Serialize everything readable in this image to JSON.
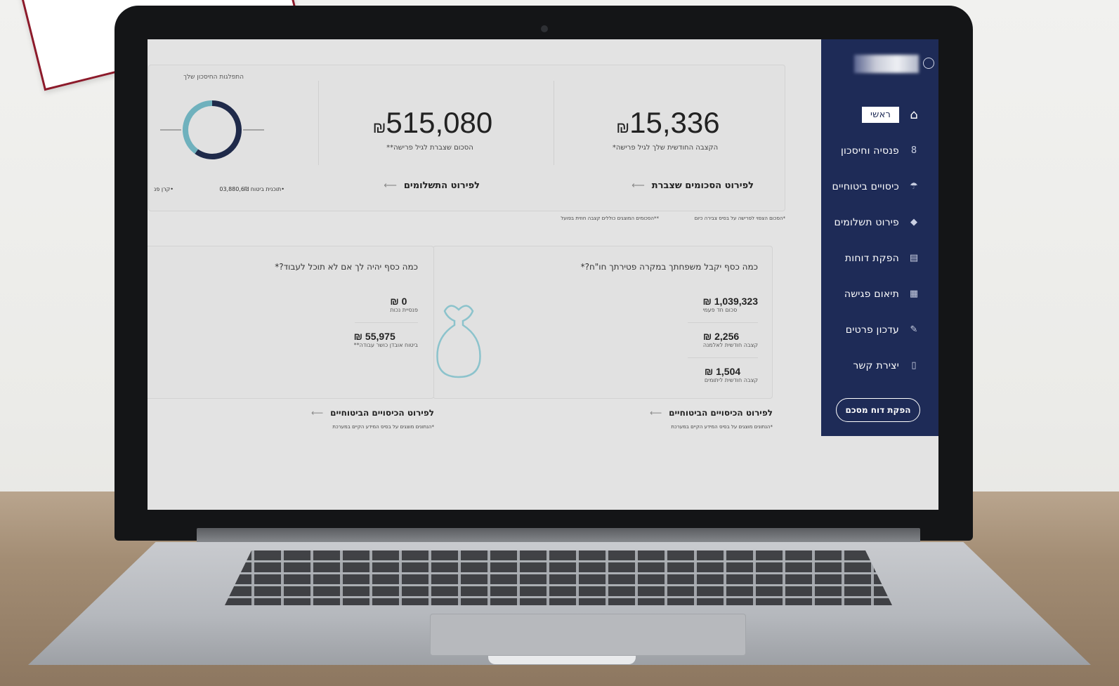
{
  "sidebar": {
    "items": [
      {
        "label": "ראשי",
        "icon": "home-icon",
        "glyph": "⌂"
      },
      {
        "label": "פנסיה וחיסכון",
        "icon": "savings-icon",
        "glyph": "8"
      },
      {
        "label": "כיסויים ביטוחיים",
        "icon": "umbrella-icon",
        "glyph": "☂"
      },
      {
        "label": "פירוט תשלומים",
        "icon": "coins-icon",
        "glyph": "◆"
      },
      {
        "label": "הפקת דוחות",
        "icon": "document-icon",
        "glyph": "▤"
      },
      {
        "label": "תיאום פגישה",
        "icon": "calendar-icon",
        "glyph": "▦"
      },
      {
        "label": "עדכון פרטים",
        "icon": "edit-icon",
        "glyph": "✎"
      },
      {
        "label": "יצירת קשר",
        "icon": "phone-icon",
        "glyph": "▯"
      }
    ],
    "report_button": "הפקת דוח מסכם"
  },
  "summary": {
    "monthly_allowance": {
      "value": "15,336",
      "currency": "₪",
      "caption": "הקצבה החודשית שלך לגיל פרישה*"
    },
    "accumulated": {
      "value": "515,080",
      "currency": "₪",
      "caption": "הסכום שצברת לגיל פרישה**"
    },
    "link_accumulated": "לפירוט הסכומים שצברת",
    "link_payments": "לפירוט התשלומים",
    "donut_title": "התפלגות החיסכון שלך",
    "legend_left": "•קרן פנ",
    "legend_right": "•תוכנית ביטוח 03,880,6₪",
    "footnote_1": "*הסכום הצפוי לפרישה על בסיס צבירה כיום",
    "footnote_2": "**הסכומים המוצגים כוללים קצבה חוזית בפועל"
  },
  "family": {
    "question": "כמה כסף יקבל משפחתך במקרה פטירתך חו\"ח?*",
    "amounts": [
      {
        "value": "1,039,323",
        "currency": "₪",
        "caption": "סכום חד פעמי"
      },
      {
        "value": "2,256",
        "currency": "₪",
        "caption": "קצבה חודשית לאלמנה"
      },
      {
        "value": "1,504",
        "currency": "₪",
        "caption": "קצבה חודשית ליתומים"
      }
    ],
    "link": "לפירוט הכיסויים הביטוחיים",
    "footnote": "*הנתונים מוצגים על בסיס המידע הקיים במערכת"
  },
  "disability": {
    "question": "כמה כסף יהיה לך אם לא תוכל לעבוד?*",
    "amounts": [
      {
        "value": "0",
        "currency": "₪",
        "caption": "פנסיית נכות"
      },
      {
        "value": "55,975",
        "currency": "₪",
        "caption": "ביטוח אובדן כושר עבודה**"
      }
    ],
    "link": "לפירוט הכיסויים הביטוחיים",
    "footnote": "*הנתונים מוצגים על בסיס המידע הקיים במערכת"
  },
  "colors": {
    "sidebar": "#1e2b57",
    "donut_primary": "#1f2a4a",
    "donut_secondary": "#6fb1bd"
  },
  "chart_data": {
    "type": "pie",
    "title": "התפלגות החיסכון שלך",
    "series": [
      {
        "name": "",
        "values": [
          60,
          40
        ]
      }
    ]
  }
}
